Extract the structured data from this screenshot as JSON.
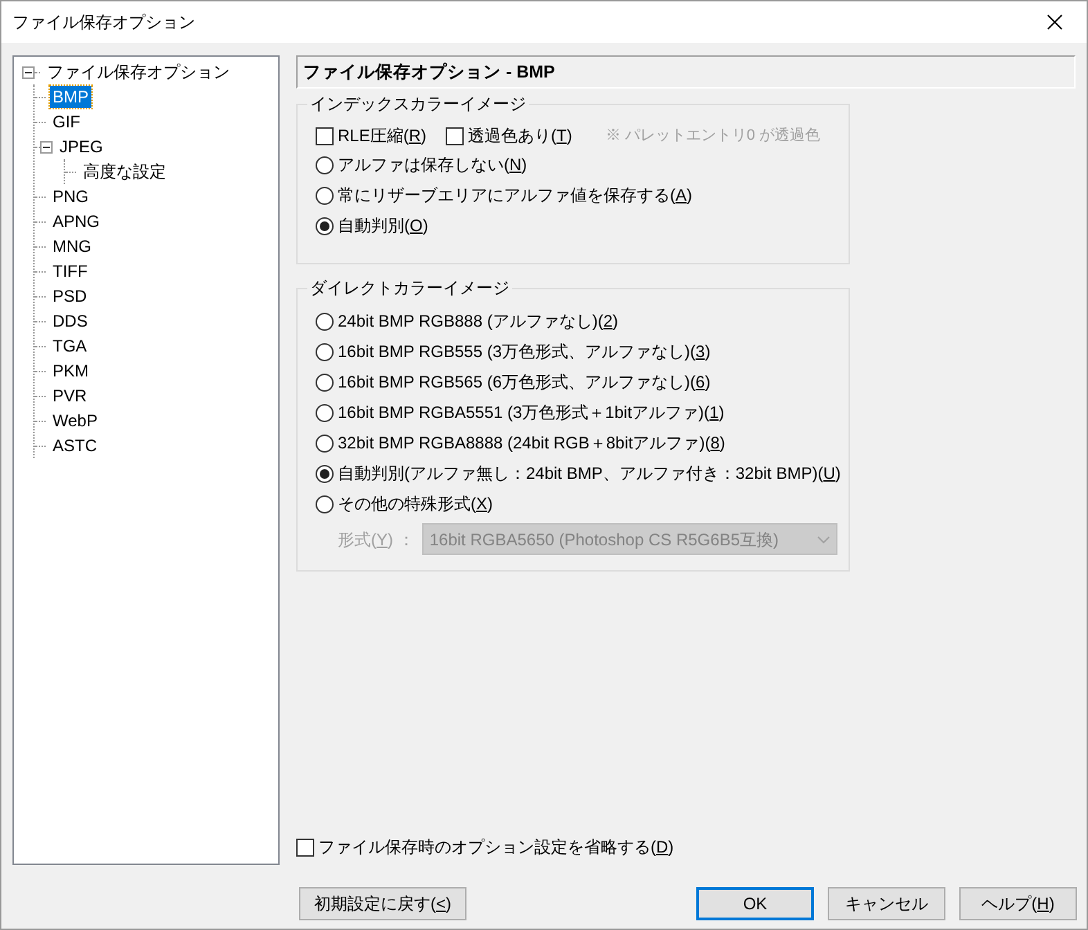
{
  "window": {
    "title": "ファイル保存オプション"
  },
  "tree": {
    "label": "ファイル保存オプション",
    "expanded": true,
    "children": [
      {
        "label": "BMP",
        "selected": true
      },
      {
        "label": "GIF",
        "selected": false
      },
      {
        "label": "JPEG",
        "selected": false,
        "expanded": true,
        "children": [
          {
            "label": "高度な設定",
            "selected": false
          }
        ]
      },
      {
        "label": "PNG",
        "selected": false
      },
      {
        "label": "APNG",
        "selected": false
      },
      {
        "label": "MNG",
        "selected": false
      },
      {
        "label": "TIFF",
        "selected": false
      },
      {
        "label": "PSD",
        "selected": false
      },
      {
        "label": "DDS",
        "selected": false
      },
      {
        "label": "TGA",
        "selected": false
      },
      {
        "label": "PKM",
        "selected": false
      },
      {
        "label": "PVR",
        "selected": false
      },
      {
        "label": "WebP",
        "selected": false
      },
      {
        "label": "ASTC",
        "selected": false
      }
    ]
  },
  "header": "ファイル保存オプション - BMP",
  "index_color": {
    "title": "インデックスカラーイメージ",
    "checkboxes": [
      {
        "label": "RLE圧縮(R)",
        "checked": false
      },
      {
        "label": "透過色あり(T)",
        "checked": false
      }
    ],
    "note": "※ パレットエントリ0 が透過色",
    "radios": [
      {
        "label": "アルファは保存しない(N)",
        "selected": false
      },
      {
        "label": "常にリザーブエリアにアルファ値を保存する(A)",
        "selected": false
      },
      {
        "label": "自動判別(O)",
        "selected": true
      }
    ]
  },
  "direct_color": {
    "title": "ダイレクトカラーイメージ",
    "radios": [
      {
        "label": "24bit BMP RGB888 (アルファなし)(2)",
        "selected": false
      },
      {
        "label": "16bit BMP RGB555 (3万色形式、アルファなし)(3)",
        "selected": false
      },
      {
        "label": "16bit BMP RGB565 (6万色形式、アルファなし)(6)",
        "selected": false
      },
      {
        "label": "16bit BMP RGBA5551 (3万色形式＋1bitアルファ)(1)",
        "selected": false
      },
      {
        "label": "32bit BMP RGBA8888 (24bit RGB＋8bitアルファ)(8)",
        "selected": false
      },
      {
        "label": "自動判別(アルファ無し：24bit BMP、アルファ付き：32bit BMP)(U)",
        "selected": true
      },
      {
        "label": "その他の特殊形式(X)",
        "selected": false
      }
    ],
    "format": {
      "label": "形式(Y)",
      "separator": "：",
      "value": "16bit RGBA5650 (Photoshop CS R5G6B5互換)",
      "disabled": true
    }
  },
  "skip_options": {
    "label": "ファイル保存時のオプション設定を省略する(D)",
    "checked": false
  },
  "reset_button": {
    "label": "初期設定に戻す(<)"
  },
  "buttons": [
    {
      "label": "OK",
      "default": true
    },
    {
      "label": "キャンセル",
      "default": false
    },
    {
      "label": "ヘルプ(H)",
      "default": false
    }
  ]
}
